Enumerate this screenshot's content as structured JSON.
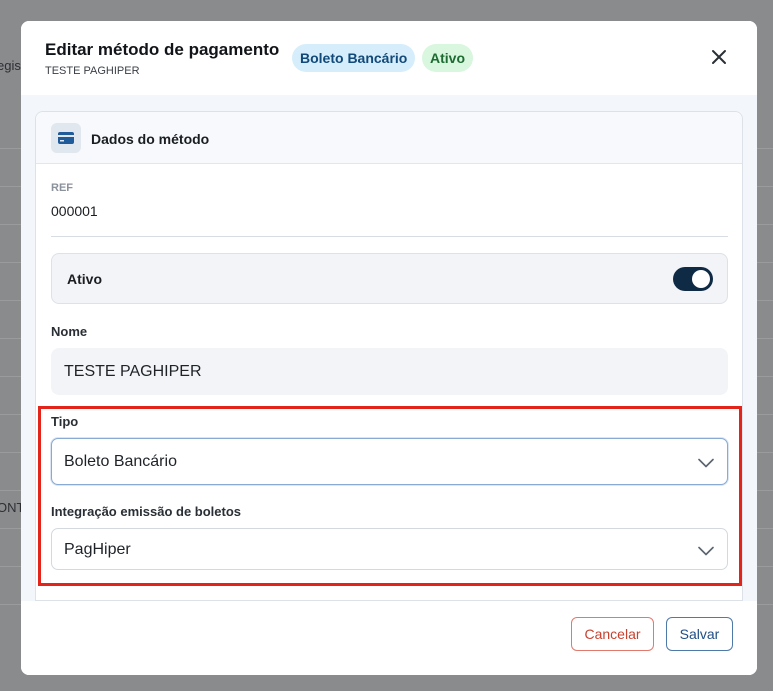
{
  "background": {
    "fragment_1": "egist",
    "fragment_2": "ONT"
  },
  "modal": {
    "title": "Editar método de pagamento",
    "subtitle": "TESTE PAGHIPER",
    "badge_type": "Boleto Bancário",
    "badge_status": "Ativo",
    "close_icon": "close-icon"
  },
  "card": {
    "icon": "credit-card-icon",
    "title": "Dados do método"
  },
  "ref": {
    "label": "REF",
    "value": "000001"
  },
  "active_toggle": {
    "label": "Ativo",
    "on": true
  },
  "name_field": {
    "label": "Nome",
    "value": "TESTE PAGHIPER"
  },
  "type_field": {
    "label": "Tipo",
    "value": "Boleto Bancário"
  },
  "integration_field": {
    "label": "Integração emissão de boletos",
    "value": "PagHiper"
  },
  "footer": {
    "cancel_label": "Cancelar",
    "save_label": "Salvar"
  },
  "colors": {
    "highlight": "#e3241b",
    "toggle_on": "#0f2a44",
    "cancel": "#c9412f",
    "save": "#1f4f86"
  }
}
